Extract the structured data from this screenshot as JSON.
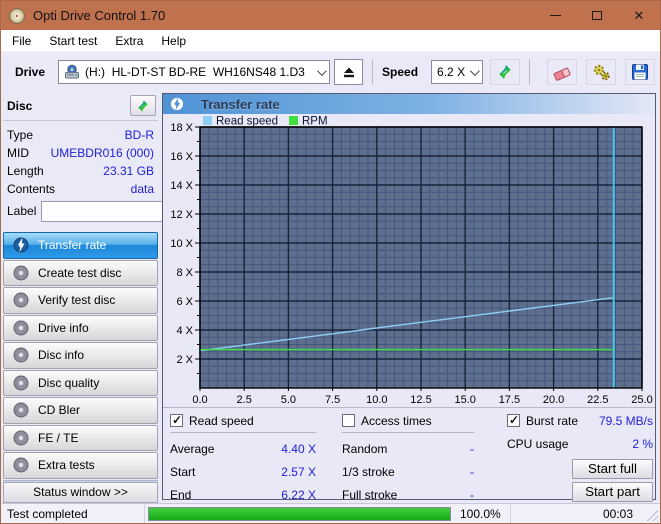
{
  "window": {
    "title": "Opti Drive Control 1.70"
  },
  "menu": {
    "items": [
      "File",
      "Start test",
      "Extra",
      "Help"
    ]
  },
  "toolbar": {
    "drive_label": "Drive",
    "drive_value": "(H:)  HL-DT-ST BD-RE  WH16NS48 1.D3",
    "speed_label": "Speed",
    "speed_value": "6.2 X"
  },
  "disc_panel": {
    "header": "Disc",
    "rows": [
      {
        "label": "Type",
        "value": "BD-R"
      },
      {
        "label": "MID",
        "value": "UMEBDR016 (000)"
      },
      {
        "label": "Length",
        "value": "23.31 GB"
      },
      {
        "label": "Contents",
        "value": "data"
      }
    ],
    "label_row": {
      "label": "Label",
      "value": ""
    }
  },
  "sidebar": {
    "items": [
      {
        "label": "Transfer rate",
        "selected": true
      },
      {
        "label": "Create test disc",
        "selected": false
      },
      {
        "label": "Verify test disc",
        "selected": false
      },
      {
        "label": "Drive info",
        "selected": false
      },
      {
        "label": "Disc info",
        "selected": false
      },
      {
        "label": "Disc quality",
        "selected": false
      },
      {
        "label": "CD Bler",
        "selected": false
      },
      {
        "label": "FE / TE",
        "selected": false
      },
      {
        "label": "Extra tests",
        "selected": false
      }
    ],
    "status_window_label": "Status window >>"
  },
  "panel": {
    "title": "Transfer rate"
  },
  "chart_data": {
    "type": "line",
    "title": "Transfer rate",
    "legend": [
      {
        "label": "Read speed",
        "color": "#8cd0f5"
      },
      {
        "label": "RPM",
        "color": "#3fe03f"
      }
    ],
    "xlim": [
      0,
      25
    ],
    "ylim": [
      0,
      18
    ],
    "x_ticks": [
      0,
      2.5,
      5,
      7.5,
      10,
      12.5,
      15,
      17.5,
      20,
      22.5,
      25
    ],
    "x_unit": "GB",
    "y_ticks": [
      2,
      4,
      6,
      8,
      10,
      12,
      14,
      16,
      18
    ],
    "y_tick_suffix": " X",
    "minor_step_x": 0.5,
    "minor_step_y": 0.5,
    "grid": true,
    "bg": "#5d6e8e",
    "grid_major": "#18233a",
    "grid_minor": "#46567c",
    "series": [
      {
        "name": "Read speed",
        "color": "#8cd0f5",
        "width": 1.4,
        "points": [
          [
            0,
            2.57
          ],
          [
            2.5,
            2.96
          ],
          [
            5,
            3.35
          ],
          [
            7.5,
            3.74
          ],
          [
            10,
            4.14
          ],
          [
            12.5,
            4.53
          ],
          [
            15,
            4.92
          ],
          [
            17.5,
            5.31
          ],
          [
            20,
            5.7
          ],
          [
            22.5,
            6.09
          ],
          [
            23.35,
            6.22
          ]
        ]
      },
      {
        "name": "RPM",
        "color": "#3fe03f",
        "width": 1.4,
        "points": [
          [
            0,
            2.65
          ],
          [
            23.35,
            2.65
          ]
        ]
      }
    ],
    "end_marker_x": 23.4,
    "end_marker_color": "#3fd2f2"
  },
  "stats": {
    "read_speed": {
      "checkbox": "Read speed",
      "checked": true,
      "rows": [
        {
          "label": "Average",
          "value": "4.40 X"
        },
        {
          "label": "Start",
          "value": "2.57 X"
        },
        {
          "label": "End",
          "value": "6.22 X"
        }
      ]
    },
    "access_times": {
      "checkbox": "Access times",
      "checked": false,
      "rows": [
        {
          "label": "Random",
          "value": "-"
        },
        {
          "label": "1/3 stroke",
          "value": "-"
        },
        {
          "label": "Full stroke",
          "value": "-"
        }
      ]
    },
    "burst": {
      "checkbox": "Burst rate",
      "checked": true,
      "value": "79.5 MB/s",
      "cpu_label": "CPU usage",
      "cpu_value": "2 %",
      "buttons": [
        "Start full",
        "Start part"
      ]
    }
  },
  "statusbar": {
    "status": "Test completed",
    "progress_value": 100,
    "progress_percent": "100.0%",
    "time": "00:03"
  }
}
